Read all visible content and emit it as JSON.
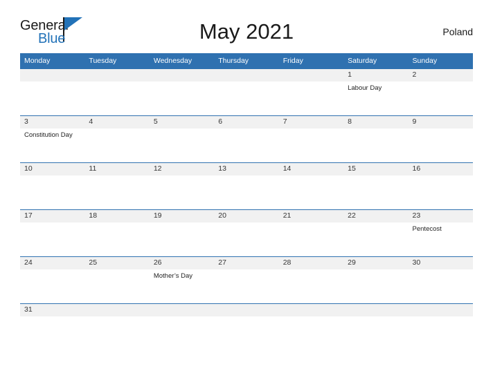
{
  "brand": {
    "name_top": "General",
    "name_bottom": "Blue",
    "accent_color": "#2272b8"
  },
  "header": {
    "title": "May 2021",
    "country": "Poland"
  },
  "theme": {
    "header_blue": "#2f71b0",
    "band_gray": "#f1f1f1",
    "rule_blue": "#2f71b0"
  },
  "calendar": {
    "weekday_headers": [
      "Monday",
      "Tuesday",
      "Wednesday",
      "Thursday",
      "Friday",
      "Saturday",
      "Sunday"
    ],
    "weeks": [
      [
        {
          "day": "",
          "event": ""
        },
        {
          "day": "",
          "event": ""
        },
        {
          "day": "",
          "event": ""
        },
        {
          "day": "",
          "event": ""
        },
        {
          "day": "",
          "event": ""
        },
        {
          "day": "1",
          "event": "Labour Day"
        },
        {
          "day": "2",
          "event": ""
        }
      ],
      [
        {
          "day": "3",
          "event": "Constitution Day"
        },
        {
          "day": "4",
          "event": ""
        },
        {
          "day": "5",
          "event": ""
        },
        {
          "day": "6",
          "event": ""
        },
        {
          "day": "7",
          "event": ""
        },
        {
          "day": "8",
          "event": ""
        },
        {
          "day": "9",
          "event": ""
        }
      ],
      [
        {
          "day": "10",
          "event": ""
        },
        {
          "day": "11",
          "event": ""
        },
        {
          "day": "12",
          "event": ""
        },
        {
          "day": "13",
          "event": ""
        },
        {
          "day": "14",
          "event": ""
        },
        {
          "day": "15",
          "event": ""
        },
        {
          "day": "16",
          "event": ""
        }
      ],
      [
        {
          "day": "17",
          "event": ""
        },
        {
          "day": "18",
          "event": ""
        },
        {
          "day": "19",
          "event": ""
        },
        {
          "day": "20",
          "event": ""
        },
        {
          "day": "21",
          "event": ""
        },
        {
          "day": "22",
          "event": ""
        },
        {
          "day": "23",
          "event": "Pentecost"
        }
      ],
      [
        {
          "day": "24",
          "event": ""
        },
        {
          "day": "25",
          "event": ""
        },
        {
          "day": "26",
          "event": "Mother’s Day"
        },
        {
          "day": "27",
          "event": ""
        },
        {
          "day": "28",
          "event": ""
        },
        {
          "day": "29",
          "event": ""
        },
        {
          "day": "30",
          "event": ""
        }
      ],
      [
        {
          "day": "31",
          "event": ""
        },
        {
          "day": "",
          "event": ""
        },
        {
          "day": "",
          "event": ""
        },
        {
          "day": "",
          "event": ""
        },
        {
          "day": "",
          "event": ""
        },
        {
          "day": "",
          "event": ""
        },
        {
          "day": "",
          "event": ""
        }
      ]
    ]
  }
}
